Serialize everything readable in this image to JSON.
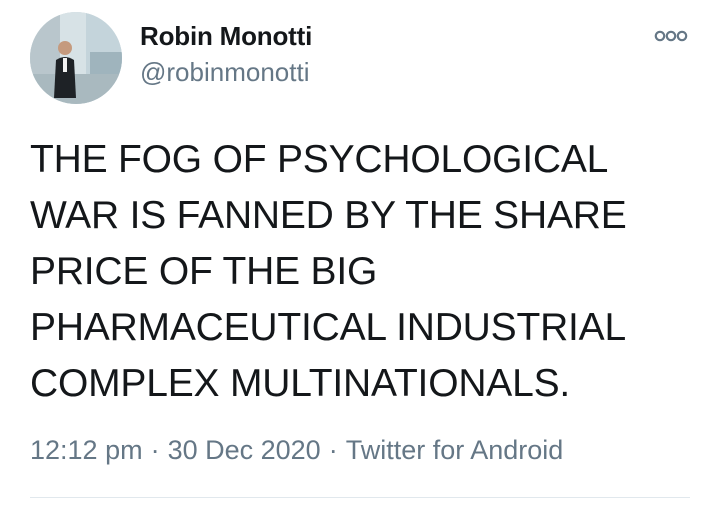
{
  "author": {
    "display_name": "Robin Monotti",
    "handle": "@robinmonotti"
  },
  "icons": {
    "avatar": "profile-photo",
    "more": "more-options-icon"
  },
  "tweet": {
    "lines": [
      "THE FOG OF PSYCHOLOGICAL",
      "WAR IS FANNED BY THE SHARE",
      "PRICE OF THE BIG",
      "PHARMACEUTICAL INDUSTRIAL",
      "COMPLEX MULTINATIONALS."
    ]
  },
  "meta": {
    "time": "12:12 pm",
    "separator": "·",
    "date": "30 Dec 2020",
    "source": "Twitter for Android"
  },
  "colors": {
    "text": "#14171a",
    "secondary": "#657786",
    "divider": "#e1e8ed"
  }
}
